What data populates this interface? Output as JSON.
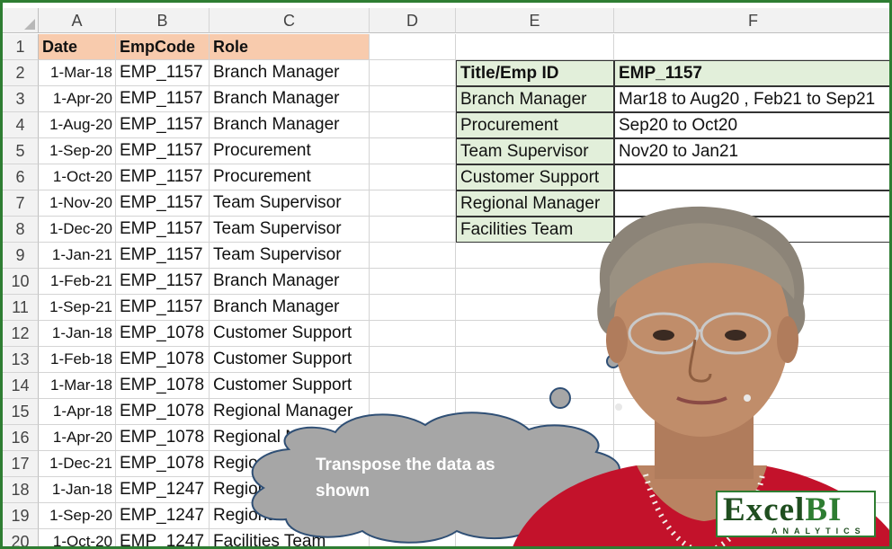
{
  "sheet": {
    "columns": [
      "A",
      "B",
      "C",
      "D",
      "E",
      "F"
    ],
    "row_numbers": [
      "1",
      "2",
      "3",
      "4",
      "5",
      "6",
      "7",
      "8",
      "9",
      "10",
      "11",
      "12",
      "13",
      "14",
      "15",
      "16",
      "17",
      "18",
      "19",
      "20"
    ],
    "headers": {
      "date": "Date",
      "empcode": "EmpCode",
      "role": "Role"
    },
    "rows": [
      {
        "date": "1-Mar-18",
        "emp": "EMP_1157",
        "role": "Branch Manager"
      },
      {
        "date": "1-Apr-20",
        "emp": "EMP_1157",
        "role": "Branch Manager"
      },
      {
        "date": "1-Aug-20",
        "emp": "EMP_1157",
        "role": "Branch Manager"
      },
      {
        "date": "1-Sep-20",
        "emp": "EMP_1157",
        "role": "Procurement"
      },
      {
        "date": "1-Oct-20",
        "emp": "EMP_1157",
        "role": "Procurement"
      },
      {
        "date": "1-Nov-20",
        "emp": "EMP_1157",
        "role": "Team Supervisor"
      },
      {
        "date": "1-Dec-20",
        "emp": "EMP_1157",
        "role": "Team Supervisor"
      },
      {
        "date": "1-Jan-21",
        "emp": "EMP_1157",
        "role": "Team Supervisor"
      },
      {
        "date": "1-Feb-21",
        "emp": "EMP_1157",
        "role": "Branch Manager"
      },
      {
        "date": "1-Sep-21",
        "emp": "EMP_1157",
        "role": "Branch Manager"
      },
      {
        "date": "1-Jan-18",
        "emp": "EMP_1078",
        "role": "Customer Support"
      },
      {
        "date": "1-Feb-18",
        "emp": "EMP_1078",
        "role": "Customer Support"
      },
      {
        "date": "1-Mar-18",
        "emp": "EMP_1078",
        "role": "Customer Support"
      },
      {
        "date": "1-Apr-18",
        "emp": "EMP_1078",
        "role": "Regional Manager"
      },
      {
        "date": "1-Apr-20",
        "emp": "EMP_1078",
        "role": "Regional Manager"
      },
      {
        "date": "1-Dec-21",
        "emp": "EMP_1078",
        "role": "Regional Manager"
      },
      {
        "date": "1-Jan-18",
        "emp": "EMP_1247",
        "role": "Regional Manager"
      },
      {
        "date": "1-Sep-20",
        "emp": "EMP_1247",
        "role": "Regional Manager"
      },
      {
        "date": "1-Oct-20",
        "emp": "EMP_1247",
        "role": "Facilities Team"
      }
    ]
  },
  "result": {
    "header_title": "Title/Emp ID",
    "header_emp": "EMP_1157",
    "rows": [
      {
        "title": "Branch Manager",
        "periods": "Mar18 to Aug20 , Feb21 to Sep21"
      },
      {
        "title": "Procurement",
        "periods": "Sep20 to Oct20"
      },
      {
        "title": "Team Supervisor",
        "periods": "Nov20 to Jan21"
      },
      {
        "title": "Customer Support",
        "periods": ""
      },
      {
        "title": "Regional Manager",
        "periods": ""
      },
      {
        "title": "Facilities Team",
        "periods": ""
      }
    ]
  },
  "callout": {
    "text": "Transpose the data as shown"
  },
  "logo": {
    "brand": "Excel",
    "accent": "BI",
    "tagline": "ANALYTICS"
  },
  "colors": {
    "header_fill": "#f8cbad",
    "green_fill": "#e2efda",
    "frame": "#2e7d32",
    "bubble": "#a6a6a6"
  }
}
